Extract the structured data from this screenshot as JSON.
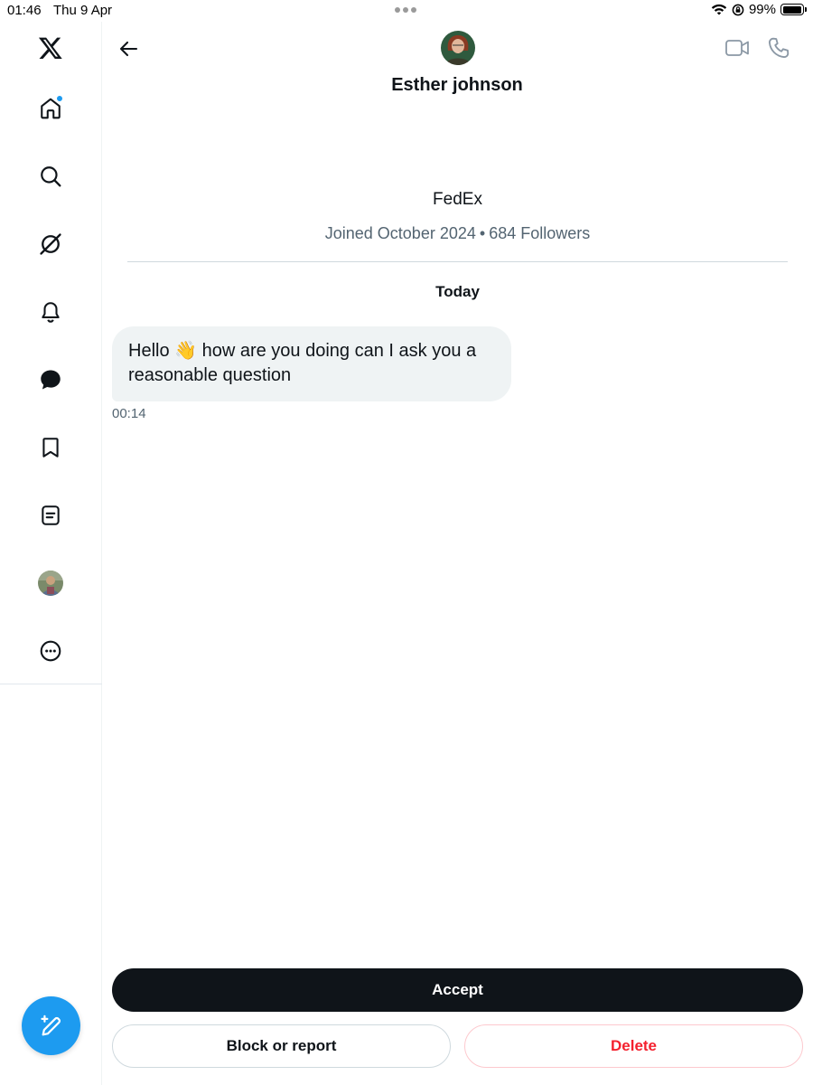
{
  "status_bar": {
    "time": "01:46",
    "date": "Thu 9 Apr",
    "battery": "99%",
    "battery_level": 0.99
  },
  "sidebar": {
    "items": [
      {
        "name": "x-logo-icon"
      },
      {
        "name": "home-icon",
        "has_notification": true
      },
      {
        "name": "search-icon"
      },
      {
        "name": "grok-icon"
      },
      {
        "name": "notifications-bell-icon"
      },
      {
        "name": "messages-icon"
      },
      {
        "name": "bookmarks-icon"
      },
      {
        "name": "lists-icon"
      },
      {
        "name": "profile-avatar"
      },
      {
        "name": "more-icon"
      }
    ],
    "compose_icon": "compose-quill-icon"
  },
  "header": {
    "name": "Esther johnson"
  },
  "profile": {
    "bio": "FedEx",
    "joined": "Joined October 2024",
    "separator": "•",
    "followers": "684 Followers"
  },
  "conversation": {
    "day_label": "Today",
    "messages": [
      {
        "text": "Hello 👋 how are you doing can I ask you a reasonable question",
        "time": "00:14"
      }
    ]
  },
  "actions": {
    "accept": "Accept",
    "block": "Block or report",
    "delete": "Delete"
  },
  "colors": {
    "accent": "#1d9bf0",
    "danger": "#f4212e",
    "text": "#0f1419",
    "muted": "#536471",
    "bubble": "#eff3f4"
  }
}
